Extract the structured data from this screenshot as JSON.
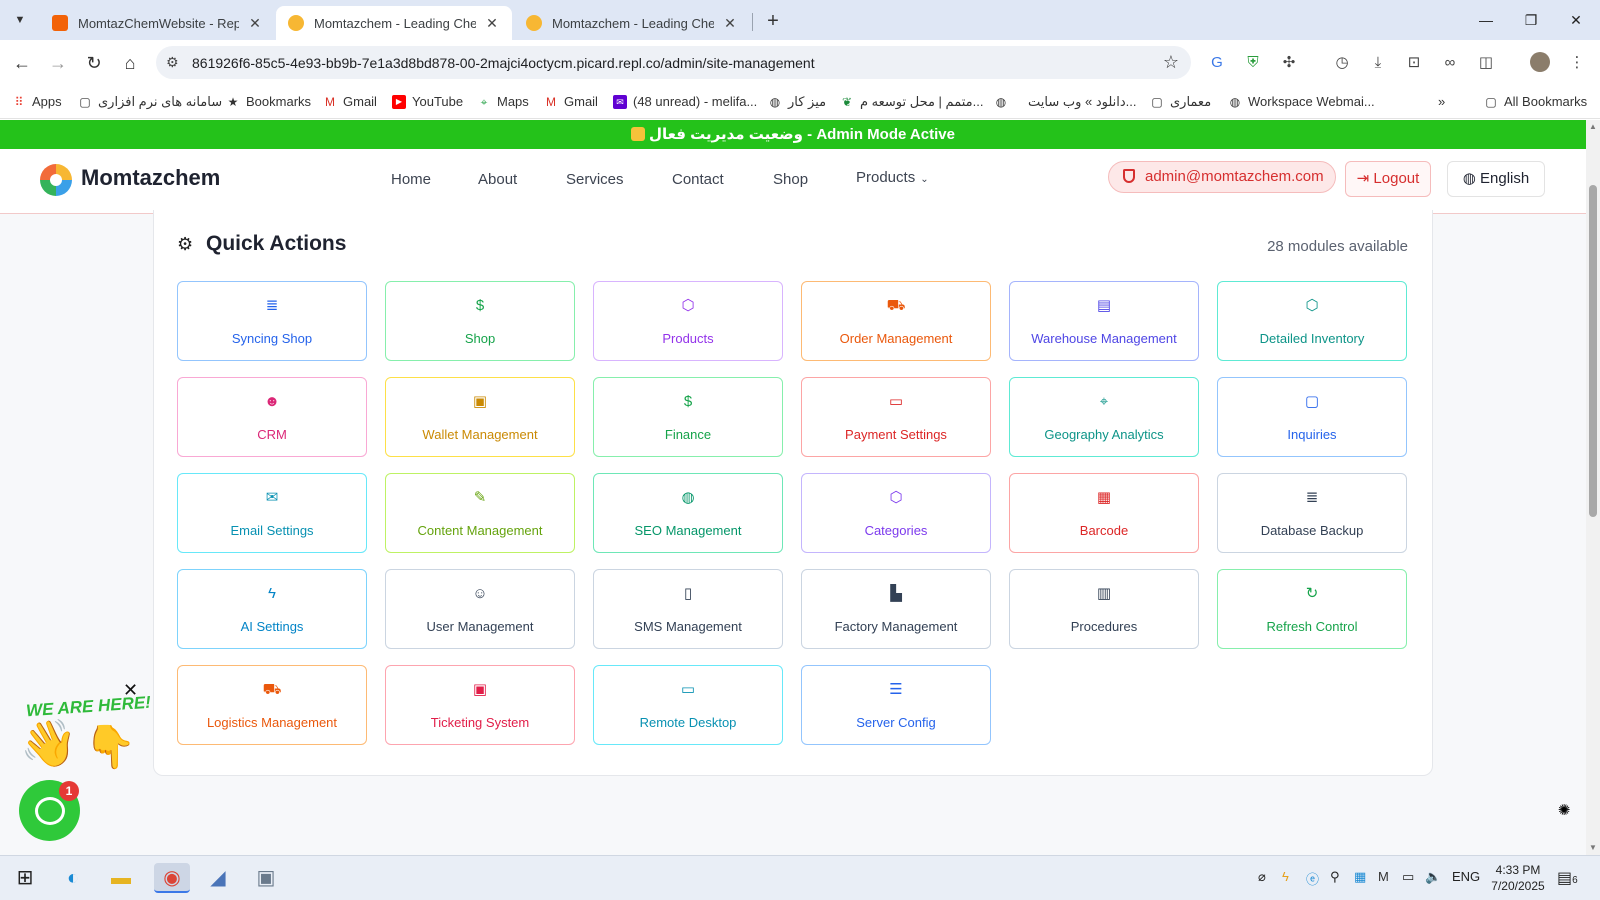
{
  "browser": {
    "tabs": [
      {
        "title": "MomtazChemWebsite - Replit",
        "favicon_color": "#f26207",
        "active": false
      },
      {
        "title": "Momtazchem - Leading Chemic",
        "favicon_color": "#f7b733",
        "active": true
      },
      {
        "title": "Momtazchem - Leading Chemic",
        "favicon_color": "#f7b733",
        "active": false
      }
    ],
    "url": "861926f6-85c5-4e93-bb9b-7e1a3d8bd878-00-2majci4octycm.picard.repl.co/admin/site-management",
    "bookmarks": [
      {
        "label": "Apps",
        "icon": "apps-grid-icon"
      },
      {
        "label": "سامانه های نرم افزاری",
        "icon": "folder-icon"
      },
      {
        "label": "Bookmarks",
        "icon": "star-icon"
      },
      {
        "label": "Gmail",
        "icon": "gmail-icon"
      },
      {
        "label": "YouTube",
        "icon": "youtube-icon"
      },
      {
        "label": "Maps",
        "icon": "maps-icon"
      },
      {
        "label": "Gmail",
        "icon": "gmail-icon"
      },
      {
        "label": "(48 unread) - melifa...",
        "icon": "mail-icon"
      },
      {
        "label": "میز کار",
        "icon": "globe-icon"
      },
      {
        "label": "متمم | محل توسعه م...",
        "icon": "leaf-icon"
      },
      {
        "label": "دانلود » وب سایت...",
        "icon": "globe-icon"
      },
      {
        "label": "معماری",
        "icon": "folder-icon"
      },
      {
        "label": "Workspace Webmai...",
        "icon": "globe-icon"
      }
    ],
    "all_bookmarks_label": "All Bookmarks"
  },
  "banner": {
    "text": "وضعیت مدیریت فعال - Admin Mode Active"
  },
  "header": {
    "brand": "Momtazchem",
    "nav": [
      "Home",
      "About",
      "Services",
      "Contact",
      "Shop",
      "Products"
    ],
    "admin_email": "admin@momtazchem.com",
    "logout_label": "Logout",
    "language_label": "English"
  },
  "quick_actions": {
    "title": "Quick Actions",
    "count_label": "28 modules available",
    "modules": [
      {
        "label": "Syncing Shop",
        "icon": "database-icon",
        "glyph": "≣",
        "color": "#2563eb",
        "border": "#93c5fd"
      },
      {
        "label": "Shop",
        "icon": "dollar-icon",
        "glyph": "$",
        "color": "#16a34a",
        "border": "#86efac"
      },
      {
        "label": "Products",
        "icon": "box-icon",
        "glyph": "⬡",
        "color": "#9333ea",
        "border": "#d8b4fe"
      },
      {
        "label": "Order Management",
        "icon": "cart-icon",
        "glyph": "⛟",
        "color": "#ea580c",
        "border": "#fdba74"
      },
      {
        "label": "Warehouse Management",
        "icon": "warehouse-icon",
        "glyph": "▤",
        "color": "#4f46e5",
        "border": "#a5b4fc"
      },
      {
        "label": "Detailed Inventory",
        "icon": "package-icon",
        "glyph": "⬡",
        "color": "#0d9488",
        "border": "#5eead4"
      },
      {
        "label": "CRM",
        "icon": "users-icon",
        "glyph": "☻",
        "color": "#db2777",
        "border": "#f9a8d4"
      },
      {
        "label": "Wallet Management",
        "icon": "wallet-icon",
        "glyph": "▣",
        "color": "#ca8a04",
        "border": "#fde047"
      },
      {
        "label": "Finance",
        "icon": "dollar-icon",
        "glyph": "$",
        "color": "#16a34a",
        "border": "#86efac"
      },
      {
        "label": "Payment Settings",
        "icon": "credit-card-icon",
        "glyph": "▭",
        "color": "#dc2626",
        "border": "#fca5a5"
      },
      {
        "label": "Geography Analytics",
        "icon": "map-pin-icon",
        "glyph": "⌖",
        "color": "#0d9488",
        "border": "#5eead4"
      },
      {
        "label": "Inquiries",
        "icon": "message-icon",
        "glyph": "▢",
        "color": "#2563eb",
        "border": "#93c5fd"
      },
      {
        "label": "Email Settings",
        "icon": "mail-icon",
        "glyph": "✉",
        "color": "#0891b2",
        "border": "#67e8f9"
      },
      {
        "label": "Content Management",
        "icon": "pen-icon",
        "glyph": "✎",
        "color": "#65a30d",
        "border": "#bef264"
      },
      {
        "label": "SEO Management",
        "icon": "globe-icon",
        "glyph": "◍",
        "color": "#059669",
        "border": "#6ee7b7"
      },
      {
        "label": "Categories",
        "icon": "box-icon",
        "glyph": "⬡",
        "color": "#7c3aed",
        "border": "#c4b5fd"
      },
      {
        "label": "Barcode",
        "icon": "qr-code-icon",
        "glyph": "▦",
        "color": "#dc2626",
        "border": "#fca5a5"
      },
      {
        "label": "Database Backup",
        "icon": "database-icon",
        "glyph": "≣",
        "color": "#334155",
        "border": "#cbd5e1"
      },
      {
        "label": "AI Settings",
        "icon": "zap-icon",
        "glyph": "ϟ",
        "color": "#0284c7",
        "border": "#7dd3fc"
      },
      {
        "label": "User Management",
        "icon": "user-cog-icon",
        "glyph": "☺",
        "color": "#334155",
        "border": "#cbd5e1"
      },
      {
        "label": "SMS Management",
        "icon": "smartphone-icon",
        "glyph": "▯",
        "color": "#334155",
        "border": "#cbd5e1"
      },
      {
        "label": "Factory Management",
        "icon": "factory-icon",
        "glyph": "▙",
        "color": "#334155",
        "border": "#cbd5e1"
      },
      {
        "label": "Procedures",
        "icon": "book-icon",
        "glyph": "▥",
        "color": "#334155",
        "border": "#cbd5e1"
      },
      {
        "label": "Refresh Control",
        "icon": "refresh-icon",
        "glyph": "↻",
        "color": "#16a34a",
        "border": "#86efac"
      },
      {
        "label": "Logistics Management",
        "icon": "truck-icon",
        "glyph": "⛟",
        "color": "#ea580c",
        "border": "#fdba74"
      },
      {
        "label": "Ticketing System",
        "icon": "ticket-icon",
        "glyph": "▣",
        "color": "#e11d48",
        "border": "#fda4af"
      },
      {
        "label": "Remote Desktop",
        "icon": "monitor-icon",
        "glyph": "▭",
        "color": "#0891b2",
        "border": "#67e8f9"
      },
      {
        "label": "Server Config",
        "icon": "server-icon",
        "glyph": "☰",
        "color": "#2563eb",
        "border": "#93c5fd"
      }
    ]
  },
  "widgets": {
    "we_are_here": "WE ARE HERE!",
    "chat_badge": "1"
  },
  "taskbar": {
    "language": "ENG",
    "time": "4:33 PM",
    "date": "7/20/2025",
    "notifications": "6"
  }
}
